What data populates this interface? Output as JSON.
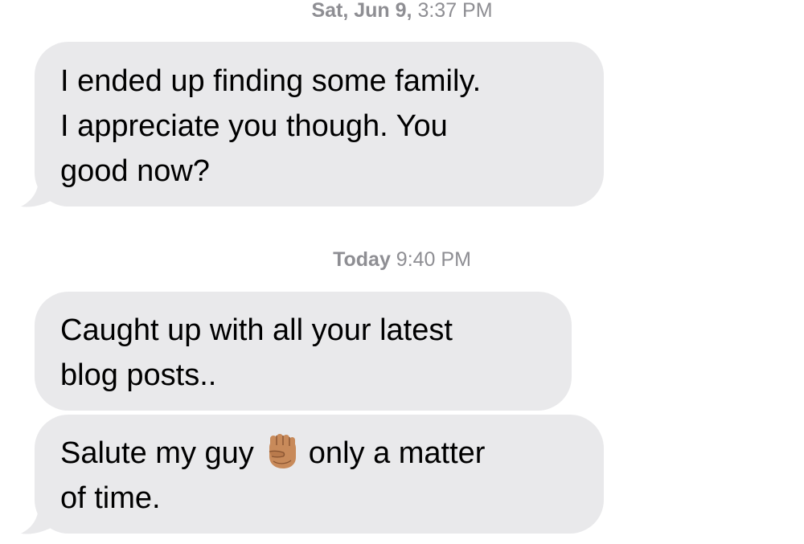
{
  "thread": {
    "timestamp_1": {
      "day": "Sat, Jun 9,",
      "time": "3:37 PM"
    },
    "message_1": {
      "lines": [
        "I ended up finding some family.",
        "I appreciate you though. You",
        "good now?"
      ]
    },
    "timestamp_2": {
      "day": "Today",
      "time": "9:40 PM"
    },
    "message_2": {
      "lines": [
        "Caught up with all your latest",
        "blog posts.."
      ]
    },
    "message_3": {
      "line1_before": "Salute my guy",
      "emoji": "raised-fist-medium-skin-tone",
      "line1_after": "only a matter",
      "line2": "of time."
    }
  },
  "colors": {
    "bubble_background": "#e9e9eb",
    "timestamp_text": "#8e8e93",
    "message_text": "#000000",
    "emoji_skin": "#c88a5a"
  }
}
